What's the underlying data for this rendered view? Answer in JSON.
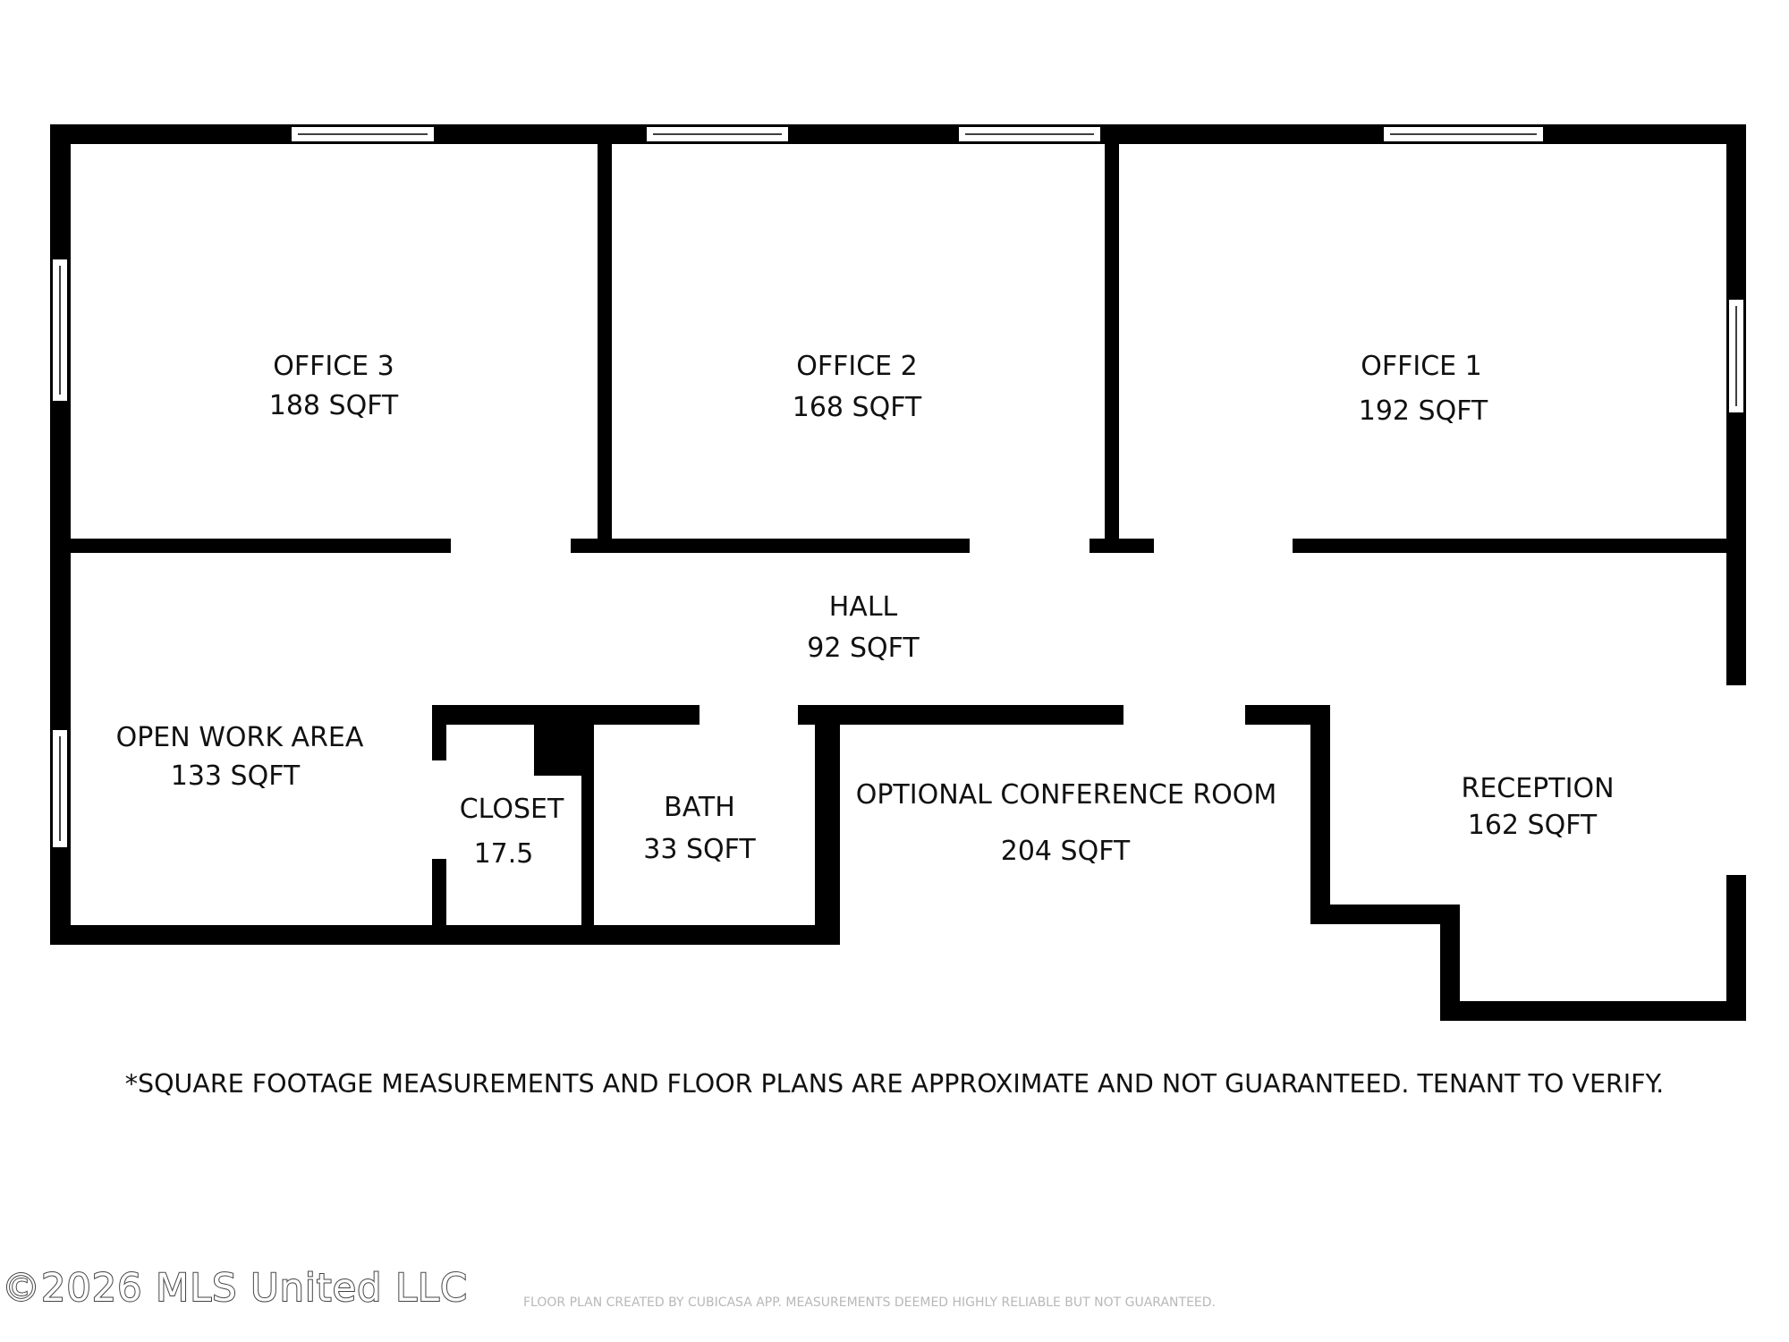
{
  "rooms": {
    "office3": {
      "name": "OFFICE 3",
      "area": "188 SQFT"
    },
    "office2": {
      "name": "OFFICE 2",
      "area": "168 SQFT"
    },
    "office1": {
      "name": "OFFICE 1",
      "area": "192 SQFT"
    },
    "hall": {
      "name": "HALL",
      "area": "92 SQFT"
    },
    "open_work": {
      "name": "OPEN WORK AREA",
      "area": "133 SQFT"
    },
    "closet": {
      "name": "CLOSET",
      "area": "17.5"
    },
    "bath": {
      "name": "BATH",
      "area": "33 SQFT"
    },
    "conference": {
      "name": "OPTIONAL CONFERENCE ROOM",
      "area": "204 SQFT"
    },
    "reception": {
      "name": "RECEPTION",
      "area": "162 SQFT"
    }
  },
  "disclaimer": "*SQUARE FOOTAGE MEASUREMENTS AND FLOOR PLANS ARE APPROXIMATE AND NOT GUARANTEED. TENANT TO VERIFY.",
  "copyright": "©2026 MLS United LLC",
  "credit": "FLOOR PLAN CREATED BY CUBICASA APP. MEASUREMENTS DEEMED HIGHLY RELIABLE BUT NOT GUARANTEED.",
  "colors": {
    "wall": "#000000",
    "window": "#ffffff",
    "background": "#ffffff"
  }
}
